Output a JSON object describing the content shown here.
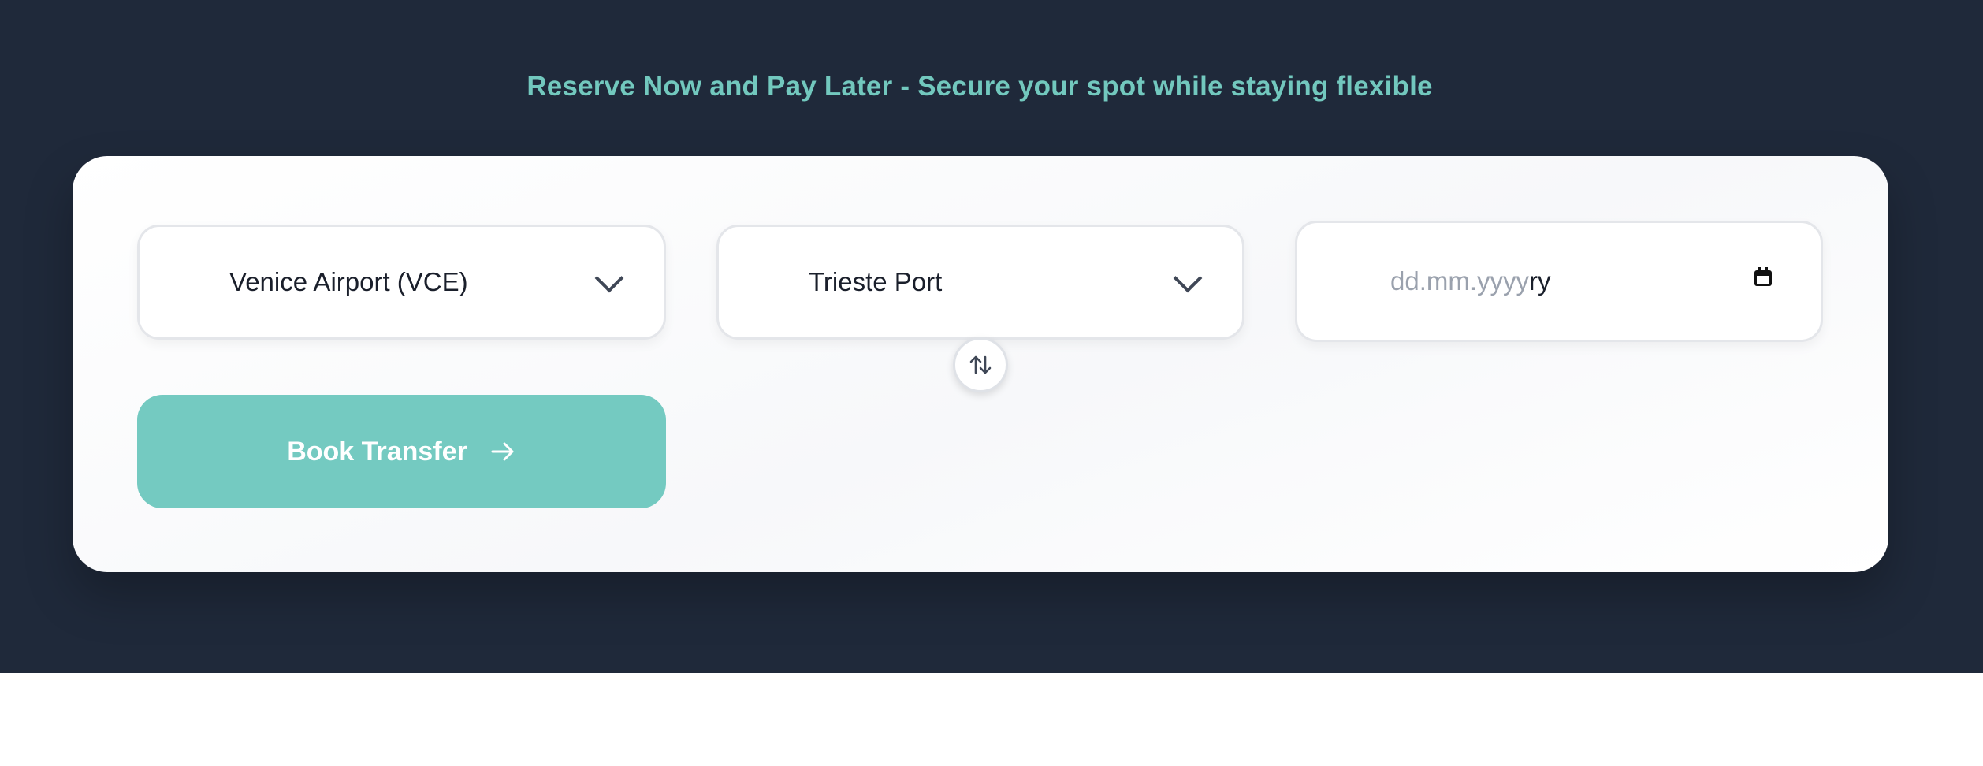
{
  "header": {
    "tagline": "Reserve Now and Pay Later - Secure your spot while staying flexible"
  },
  "booking": {
    "from": {
      "value": "Venice Airport (VCE)",
      "icon": "chevron-down-icon"
    },
    "to": {
      "value": "Trieste Port",
      "icon": "chevron-down-icon"
    },
    "date": {
      "placeholder": "dd.mm.yyyy",
      "overlap_text": "ry",
      "icon": "calendar-icon"
    },
    "swap": {
      "icon": "swap-vertical-icon"
    },
    "submit": {
      "label": "Book Transfer",
      "icon": "arrow-right-icon"
    }
  },
  "colors": {
    "hero_background": "#1f293a",
    "accent": "#74cac1",
    "tagline": "#72c8be",
    "card_background": "#ffffff",
    "page_background": "#ffffff"
  }
}
